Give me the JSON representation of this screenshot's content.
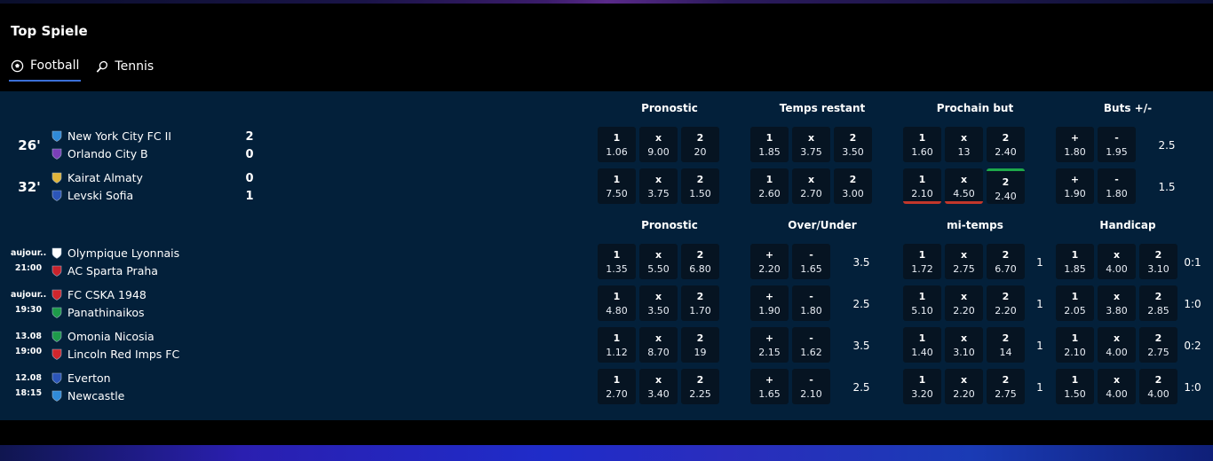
{
  "section_title": "Top Spiele",
  "tabs": [
    {
      "label": "Football",
      "icon": "football-icon",
      "active": true
    },
    {
      "label": "Tennis",
      "icon": "tennis-racket-icon",
      "active": false
    }
  ],
  "live_headers": [
    "Pronostic",
    "Temps restant",
    "Prochain but",
    "Buts +/-"
  ],
  "upcoming_headers": [
    "Pronostic",
    "Over/Under",
    "mi-temps",
    "Handicap"
  ],
  "live_matches": [
    {
      "time": "26'",
      "home": {
        "name": "New York City FC II",
        "score": "2",
        "crest_color": "#2f8ad8"
      },
      "away": {
        "name": "Orlando City B",
        "score": "0",
        "crest_color": "#7a3fb8"
      },
      "pronostic": [
        {
          "k": "1",
          "v": "1.06"
        },
        {
          "k": "x",
          "v": "9.00"
        },
        {
          "k": "2",
          "v": "20"
        }
      ],
      "temps_restant": [
        {
          "k": "1",
          "v": "1.85"
        },
        {
          "k": "x",
          "v": "3.75"
        },
        {
          "k": "2",
          "v": "3.50"
        }
      ],
      "prochain_but": [
        {
          "k": "1",
          "v": "1.60"
        },
        {
          "k": "x",
          "v": "13"
        },
        {
          "k": "2",
          "v": "2.40"
        }
      ],
      "buts": [
        {
          "k": "+",
          "v": "1.80"
        },
        {
          "k": "-",
          "v": "1.95"
        }
      ],
      "buts_line": "2.5"
    },
    {
      "time": "32'",
      "home": {
        "name": "Kairat Almaty",
        "score": "0",
        "crest_color": "#e0b43a"
      },
      "away": {
        "name": "Levski Sofia",
        "score": "1",
        "crest_color": "#2b55b8"
      },
      "pronostic": [
        {
          "k": "1",
          "v": "7.50"
        },
        {
          "k": "x",
          "v": "3.75"
        },
        {
          "k": "2",
          "v": "1.50"
        }
      ],
      "temps_restant": [
        {
          "k": "1",
          "v": "2.60"
        },
        {
          "k": "x",
          "v": "2.70"
        },
        {
          "k": "2",
          "v": "3.00"
        }
      ],
      "prochain_but": [
        {
          "k": "1",
          "v": "2.10"
        },
        {
          "k": "x",
          "v": "4.50"
        },
        {
          "k": "2",
          "v": "2.40"
        }
      ],
      "buts": [
        {
          "k": "+",
          "v": "1.90"
        },
        {
          "k": "-",
          "v": "1.80"
        }
      ],
      "buts_line": "1.5"
    }
  ],
  "upcoming_matches": [
    {
      "date": "aujour...",
      "time": "21:00",
      "home": {
        "name": "Olympique Lyonnais",
        "crest_color": "#ffffff"
      },
      "away": {
        "name": "AC Sparta Praha",
        "crest_color": "#c8232c"
      },
      "pronostic": [
        {
          "k": "1",
          "v": "1.35"
        },
        {
          "k": "x",
          "v": "5.50"
        },
        {
          "k": "2",
          "v": "6.80"
        }
      ],
      "over_under": [
        {
          "k": "+",
          "v": "2.20"
        },
        {
          "k": "-",
          "v": "1.65"
        }
      ],
      "ou_line": "3.5",
      "mi_temps": [
        {
          "k": "1",
          "v": "1.72"
        },
        {
          "k": "x",
          "v": "2.75"
        },
        {
          "k": "2",
          "v": "6.70"
        }
      ],
      "mi_line": "1",
      "handicap": [
        {
          "k": "1",
          "v": "1.85"
        },
        {
          "k": "x",
          "v": "4.00"
        },
        {
          "k": "2",
          "v": "3.10"
        }
      ],
      "hc_line": "0:1"
    },
    {
      "date": "aujour...",
      "time": "19:30",
      "home": {
        "name": "FC CSKA 1948",
        "crest_color": "#d0262d"
      },
      "away": {
        "name": "Panathinaikos",
        "crest_color": "#1e9a4a"
      },
      "pronostic": [
        {
          "k": "1",
          "v": "4.80"
        },
        {
          "k": "x",
          "v": "3.50"
        },
        {
          "k": "2",
          "v": "1.70"
        }
      ],
      "over_under": [
        {
          "k": "+",
          "v": "1.90"
        },
        {
          "k": "-",
          "v": "1.80"
        }
      ],
      "ou_line": "2.5",
      "mi_temps": [
        {
          "k": "1",
          "v": "5.10"
        },
        {
          "k": "x",
          "v": "2.20"
        },
        {
          "k": "2",
          "v": "2.20"
        }
      ],
      "mi_line": "1",
      "handicap": [
        {
          "k": "1",
          "v": "2.05"
        },
        {
          "k": "x",
          "v": "3.80"
        },
        {
          "k": "2",
          "v": "2.85"
        }
      ],
      "hc_line": "1:0"
    },
    {
      "date": "13.08",
      "time": "19:00",
      "home": {
        "name": "Omonia Nicosia",
        "crest_color": "#1e9a4a"
      },
      "away": {
        "name": "Lincoln Red Imps FC",
        "crest_color": "#d0262d"
      },
      "pronostic": [
        {
          "k": "1",
          "v": "1.12"
        },
        {
          "k": "x",
          "v": "8.70"
        },
        {
          "k": "2",
          "v": "19"
        }
      ],
      "over_under": [
        {
          "k": "+",
          "v": "2.15"
        },
        {
          "k": "-",
          "v": "1.62"
        }
      ],
      "ou_line": "3.5",
      "mi_temps": [
        {
          "k": "1",
          "v": "1.40"
        },
        {
          "k": "x",
          "v": "3.10"
        },
        {
          "k": "2",
          "v": "14"
        }
      ],
      "mi_line": "1",
      "handicap": [
        {
          "k": "1",
          "v": "2.10"
        },
        {
          "k": "x",
          "v": "4.00"
        },
        {
          "k": "2",
          "v": "2.75"
        }
      ],
      "hc_line": "0:2"
    },
    {
      "date": "12.08",
      "time": "18:15",
      "home": {
        "name": "Everton",
        "crest_color": "#2b55b8"
      },
      "away": {
        "name": "Newcastle",
        "crest_color": "#2f8ad8"
      },
      "pronostic": [
        {
          "k": "1",
          "v": "2.70"
        },
        {
          "k": "x",
          "v": "3.40"
        },
        {
          "k": "2",
          "v": "2.25"
        }
      ],
      "over_under": [
        {
          "k": "+",
          "v": "1.65"
        },
        {
          "k": "-",
          "v": "2.10"
        }
      ],
      "ou_line": "2.5",
      "mi_temps": [
        {
          "k": "1",
          "v": "3.20"
        },
        {
          "k": "x",
          "v": "2.20"
        },
        {
          "k": "2",
          "v": "2.75"
        }
      ],
      "mi_line": "1",
      "handicap": [
        {
          "k": "1",
          "v": "1.50"
        },
        {
          "k": "x",
          "v": "4.00"
        },
        {
          "k": "2",
          "v": "4.00"
        }
      ],
      "hc_line": "1:0"
    }
  ],
  "odds_movement": {
    "down_color": "#c3372b",
    "up_color": "#1ea84a"
  }
}
